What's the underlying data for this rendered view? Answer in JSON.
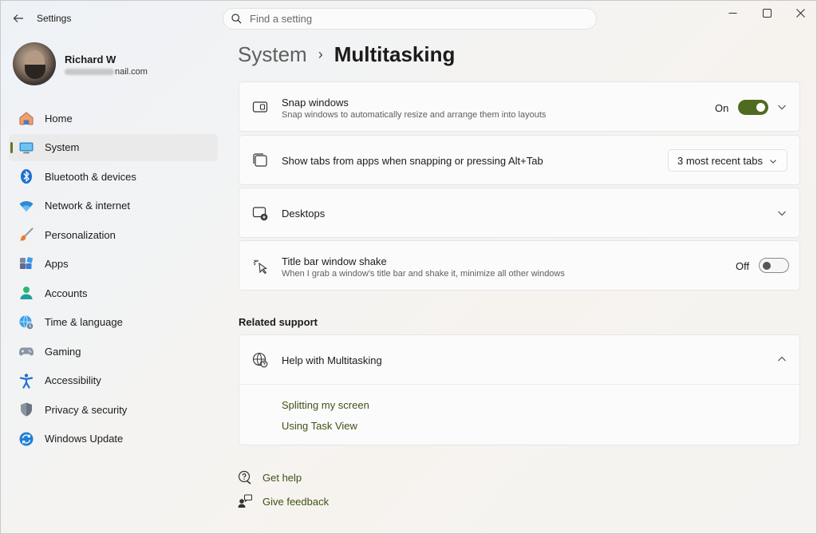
{
  "window": {
    "title": "Settings",
    "controls": [
      "minimize-icon",
      "maximize-icon",
      "close-icon"
    ]
  },
  "search": {
    "placeholder": "Find a setting"
  },
  "profile": {
    "name": "Richard W",
    "email_visible": "nail.com"
  },
  "sidebar": {
    "items": [
      {
        "label": "Home",
        "icon": "home-icon"
      },
      {
        "label": "System",
        "icon": "system-icon",
        "selected": true
      },
      {
        "label": "Bluetooth & devices",
        "icon": "bluetooth-icon"
      },
      {
        "label": "Network & internet",
        "icon": "wifi-icon"
      },
      {
        "label": "Personalization",
        "icon": "brush-icon"
      },
      {
        "label": "Apps",
        "icon": "apps-icon"
      },
      {
        "label": "Accounts",
        "icon": "accounts-icon"
      },
      {
        "label": "Time & language",
        "icon": "globe-clock-icon"
      },
      {
        "label": "Gaming",
        "icon": "gamepad-icon"
      },
      {
        "label": "Accessibility",
        "icon": "accessibility-icon"
      },
      {
        "label": "Privacy & security",
        "icon": "shield-icon"
      },
      {
        "label": "Windows Update",
        "icon": "update-icon"
      }
    ]
  },
  "breadcrumb": {
    "parent": "System",
    "separator": "›",
    "current": "Multitasking"
  },
  "settings": {
    "snap": {
      "title": "Snap windows",
      "desc": "Snap windows to automatically resize and arrange them into layouts",
      "state": "On"
    },
    "tabs": {
      "title": "Show tabs from apps when snapping or pressing Alt+Tab",
      "value": "3 most recent tabs"
    },
    "desktops": {
      "title": "Desktops"
    },
    "shake": {
      "title": "Title bar window shake",
      "desc": "When I grab a window's title bar and shake it, minimize all other windows",
      "state": "Off"
    }
  },
  "related": {
    "heading": "Related support",
    "help_title": "Help with Multitasking",
    "links": [
      "Splitting my screen",
      "Using Task View"
    ]
  },
  "footer": {
    "get_help": "Get help",
    "give_feedback": "Give feedback"
  },
  "colors": {
    "accent": "#4f6b1f",
    "link": "#3d5216"
  }
}
